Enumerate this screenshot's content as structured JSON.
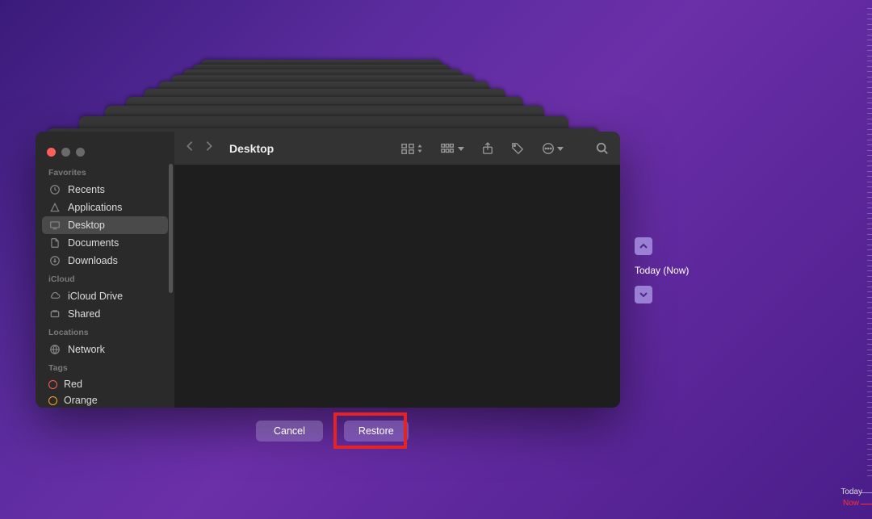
{
  "window": {
    "title": "Desktop"
  },
  "sidebar": {
    "sections": {
      "favorites": {
        "title": "Favorites",
        "items": [
          {
            "label": "Recents",
            "icon": "clock-icon"
          },
          {
            "label": "Applications",
            "icon": "apps-icon"
          },
          {
            "label": "Desktop",
            "icon": "desktop-icon",
            "selected": true
          },
          {
            "label": "Documents",
            "icon": "document-icon"
          },
          {
            "label": "Downloads",
            "icon": "downloads-icon"
          }
        ]
      },
      "icloud": {
        "title": "iCloud",
        "items": [
          {
            "label": "iCloud Drive",
            "icon": "cloud-icon"
          },
          {
            "label": "Shared",
            "icon": "shared-icon"
          }
        ]
      },
      "locations": {
        "title": "Locations",
        "items": [
          {
            "label": "Network",
            "icon": "network-icon"
          }
        ]
      },
      "tags": {
        "title": "Tags",
        "items": [
          {
            "label": "Red",
            "color": "red"
          },
          {
            "label": "Orange",
            "color": "orange"
          }
        ]
      }
    }
  },
  "timeline": {
    "current_label": "Today (Now)",
    "edge_today": "Today",
    "edge_now": "Now"
  },
  "actions": {
    "cancel_label": "Cancel",
    "restore_label": "Restore"
  }
}
